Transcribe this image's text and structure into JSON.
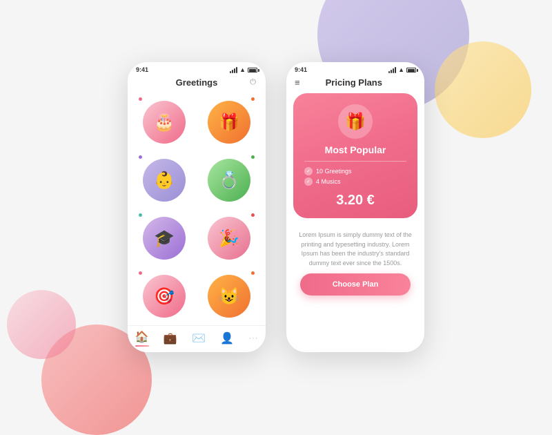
{
  "app": {
    "background_blobs": [
      "purple",
      "yellow",
      "red",
      "pink"
    ]
  },
  "screen1": {
    "status_time": "9:41",
    "title": "Greetings",
    "power_label": "⏻",
    "grid_items": [
      {
        "id": 1,
        "icon": "🎂",
        "color_class": "bg-pink-light",
        "dot_color": "dot-pink",
        "dot_pos": "top-left"
      },
      {
        "id": 2,
        "icon": "🎁",
        "color_class": "bg-orange",
        "dot_color": "dot-orange",
        "dot_pos": "top-right"
      },
      {
        "id": 3,
        "icon": "👶",
        "color_class": "bg-lavender",
        "dot_color": "dot-purple",
        "dot_pos": "top-left"
      },
      {
        "id": 4,
        "icon": "💍",
        "color_class": "bg-green",
        "dot_color": "dot-green",
        "dot_pos": "top-right"
      },
      {
        "id": 5,
        "icon": "🎓",
        "color_class": "bg-purple-light",
        "dot_color": "dot-teal",
        "dot_pos": "top-left"
      },
      {
        "id": 6,
        "icon": "🎉",
        "color_class": "bg-pink-soft",
        "dot_color": "dot-red",
        "dot_pos": "top-right"
      },
      {
        "id": 7,
        "icon": "🎯",
        "color_class": "bg-pink-light",
        "dot_color": "dot-pink",
        "dot_pos": "top-left"
      },
      {
        "id": 8,
        "icon": "😺",
        "color_class": "bg-orange",
        "dot_color": "dot-orange",
        "dot_pos": "top-right"
      }
    ],
    "nav_items": [
      {
        "icon": "🏠",
        "active": true
      },
      {
        "icon": "💼",
        "active": false
      },
      {
        "icon": "✉️",
        "active": false
      },
      {
        "icon": "👤",
        "active": false
      },
      {
        "icon": "···",
        "active": false
      }
    ]
  },
  "screen2": {
    "status_time": "9:41",
    "title": "Pricing Plans",
    "hamburger": "≡",
    "card": {
      "icon": "🎁",
      "badge": "Most Popular",
      "features": [
        "10 Greetings",
        "4 Musics"
      ],
      "price": "3.20 €"
    },
    "description": "Lorem Ipsum is simply dummy text of the printing and typesetting industry. Lorem Ipsum has been the industry's standard dummy text ever since the 1500s.",
    "choose_plan_label": "Choose Plan"
  }
}
